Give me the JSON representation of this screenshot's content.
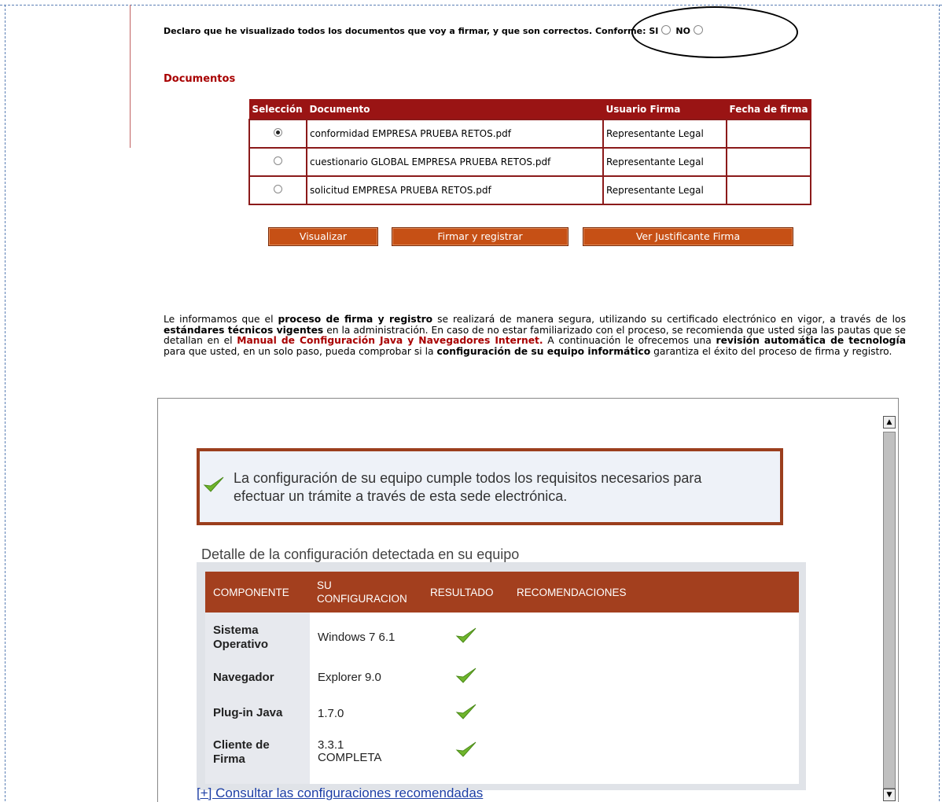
{
  "declaration": {
    "text": "Declaro que he visualizado todos los documentos que voy a firmar, y que son correctos. Conforme:",
    "si_label": "SI",
    "no_label": "NO"
  },
  "documents": {
    "heading": "Documentos",
    "columns": [
      "Selección",
      "Documento",
      "Usuario Firma",
      "Fecha de firma"
    ],
    "rows": [
      {
        "selected": true,
        "document": "conformidad EMPRESA PRUEBA RETOS.pdf",
        "user": "Representante Legal",
        "date": ""
      },
      {
        "selected": false,
        "document": "cuestionario GLOBAL EMPRESA PRUEBA RETOS.pdf",
        "user": "Representante Legal",
        "date": ""
      },
      {
        "selected": false,
        "document": "solicitud EMPRESA PRUEBA RETOS.pdf",
        "user": "Representante Legal",
        "date": ""
      }
    ]
  },
  "buttons": {
    "view": "Visualizar",
    "sign": "Firmar y registrar",
    "receipt": "Ver Justificante Firma"
  },
  "info": {
    "p1": "Le informamos que el ",
    "b1": "proceso de firma y registro",
    "p2": " se realizará de manera segura, utilizando su certificado electrónico en vigor, a través de los ",
    "b2": "estándares técnicos vigentes",
    "p3": " en la administración. En caso de no estar familiarizado con el proceso, se recomienda que usted siga las pautas que se detallan en el ",
    "link": "Manual de Configuración Java y Navegadores Internet.",
    "p4": " A continuación le ofrecemos una ",
    "b3": "revisión automática de tecnología",
    "p5": " para que usted, en un solo paso, pueda comprobar si la ",
    "b4": "configuración de su equipo informático",
    "p6": " garantiza el éxito del proceso de firma y registro."
  },
  "check_panel": {
    "ok_line1": "La configuración de su equipo cumple todos los requisitos necesarios para",
    "ok_line2": "efectuar un trámite a través de esta sede electrónica.",
    "detail_title": "Detalle de la configuración detectada en su equipo",
    "headers": {
      "component": "COMPONENTE",
      "config_1": "SU",
      "config_2": "CONFIGURACION",
      "result": "RESULTADO",
      "recommendations": "RECOMENDACIONES"
    },
    "rows": [
      {
        "label_1": "Sistema",
        "label_2": "Operativo",
        "value_1": "Windows 7 6.1",
        "value_2": ""
      },
      {
        "label_1": "Navegador",
        "label_2": "",
        "value_1": "Explorer 9.0",
        "value_2": ""
      },
      {
        "label_1": "Plug-in Java",
        "label_2": "",
        "value_1": "1.7.0",
        "value_2": ""
      },
      {
        "label_1": "Cliente de",
        "label_2": "Firma",
        "value_1": "3.3.1",
        "value_2": "COMPLETA"
      }
    ],
    "link": "[+] Consultar las configuraciones recomendadas",
    "result_icon": "green-check-icon"
  },
  "colors": {
    "accent_red": "#9a1414",
    "button_orange": "#c65015",
    "header_brown": "#a33f1e"
  }
}
